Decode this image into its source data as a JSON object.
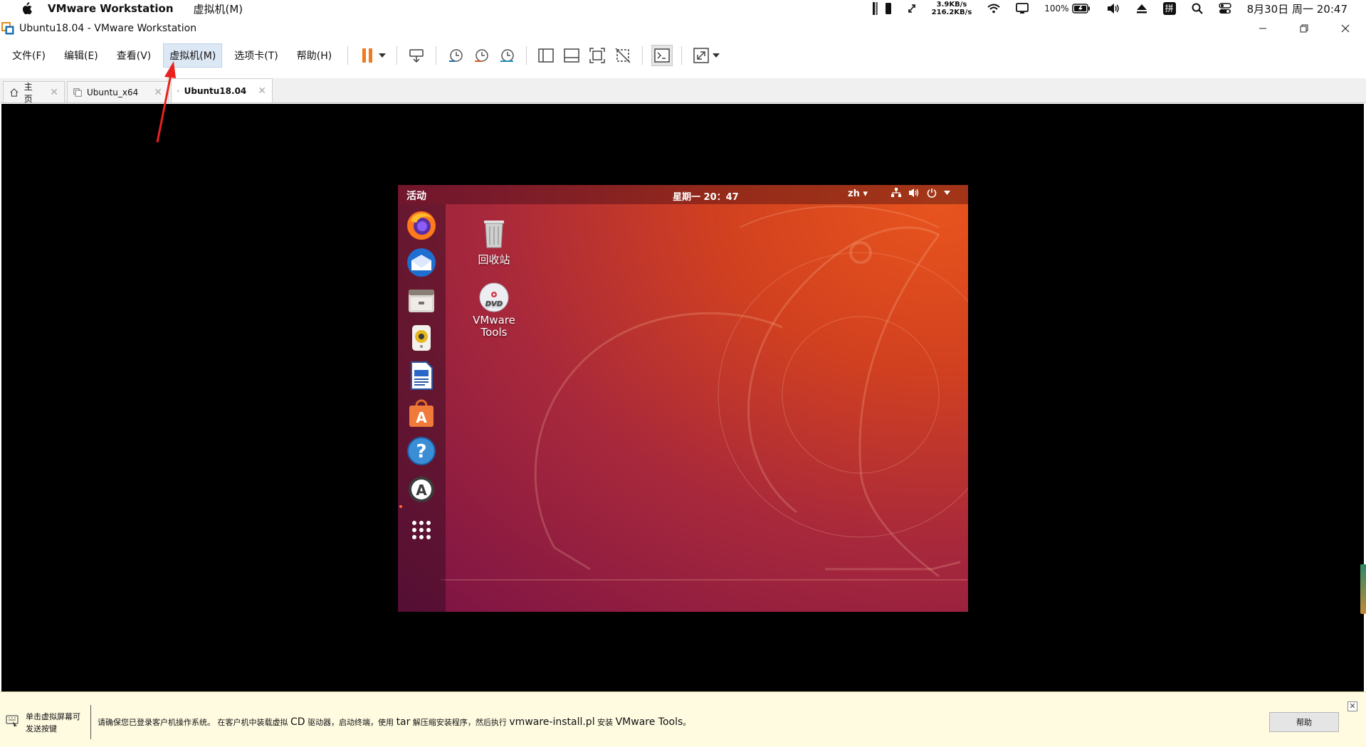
{
  "mac_menubar": {
    "app_name": "VMware Workstation",
    "menus": [
      "虚拟机(M)"
    ],
    "net_up": "3.9KB/s",
    "net_down": "216.2KB/s",
    "battery_percent": "100%",
    "clock": "8月30日 周一 20:47",
    "input_method": "拼"
  },
  "window": {
    "title": "Ubuntu18.04 - VMware Workstation"
  },
  "menubar": {
    "items": [
      "文件(F)",
      "编辑(E)",
      "查看(V)",
      "虚拟机(M)",
      "选项卡(T)",
      "帮助(H)"
    ],
    "active_index": 3
  },
  "tabs": [
    {
      "label": "主页",
      "icon": "home-icon",
      "active": false
    },
    {
      "label": "Ubuntu_x64",
      "icon": "vm-icon",
      "active": false
    },
    {
      "label": "Ubuntu18.04",
      "icon": "vm-running-icon",
      "active": true
    }
  ],
  "ubuntu": {
    "activities": "活动",
    "clock": "星期一 20：47",
    "lang": "zh",
    "dock_apps": [
      "firefox-icon",
      "thunderbird-icon",
      "files-icon",
      "rhythmbox-icon",
      "writer-icon",
      "software-icon",
      "help-icon",
      "updater-icon",
      "app-grid-icon"
    ],
    "desktop": [
      {
        "label": "回收站",
        "icon": "trash-icon"
      },
      {
        "label_line1": "VMware",
        "label_line2": "Tools",
        "icon": "dvd-icon"
      }
    ]
  },
  "infobar": {
    "hint_line1": "单击虚拟屏幕可",
    "hint_line2": "发送按键",
    "msg_a": "请确保您已登录客户机操作系统。 在客户机中装载虚拟 ",
    "msg_cd": "CD",
    "msg_b": " 驱动器，启动终端，使用 ",
    "msg_tar": "tar",
    "msg_c": " 解压缩安装程序，然后执行 ",
    "msg_pl": "vmware-install.pl",
    "msg_d": " 安装 ",
    "msg_tools": "VMware Tools",
    "msg_e": "。",
    "help_button": "帮助",
    "close_symbol": "✕"
  },
  "colors": {
    "accent_pause": "#f07a22",
    "annotation_arrow": "#e8221e",
    "infobar_bg": "#fffbe1"
  }
}
